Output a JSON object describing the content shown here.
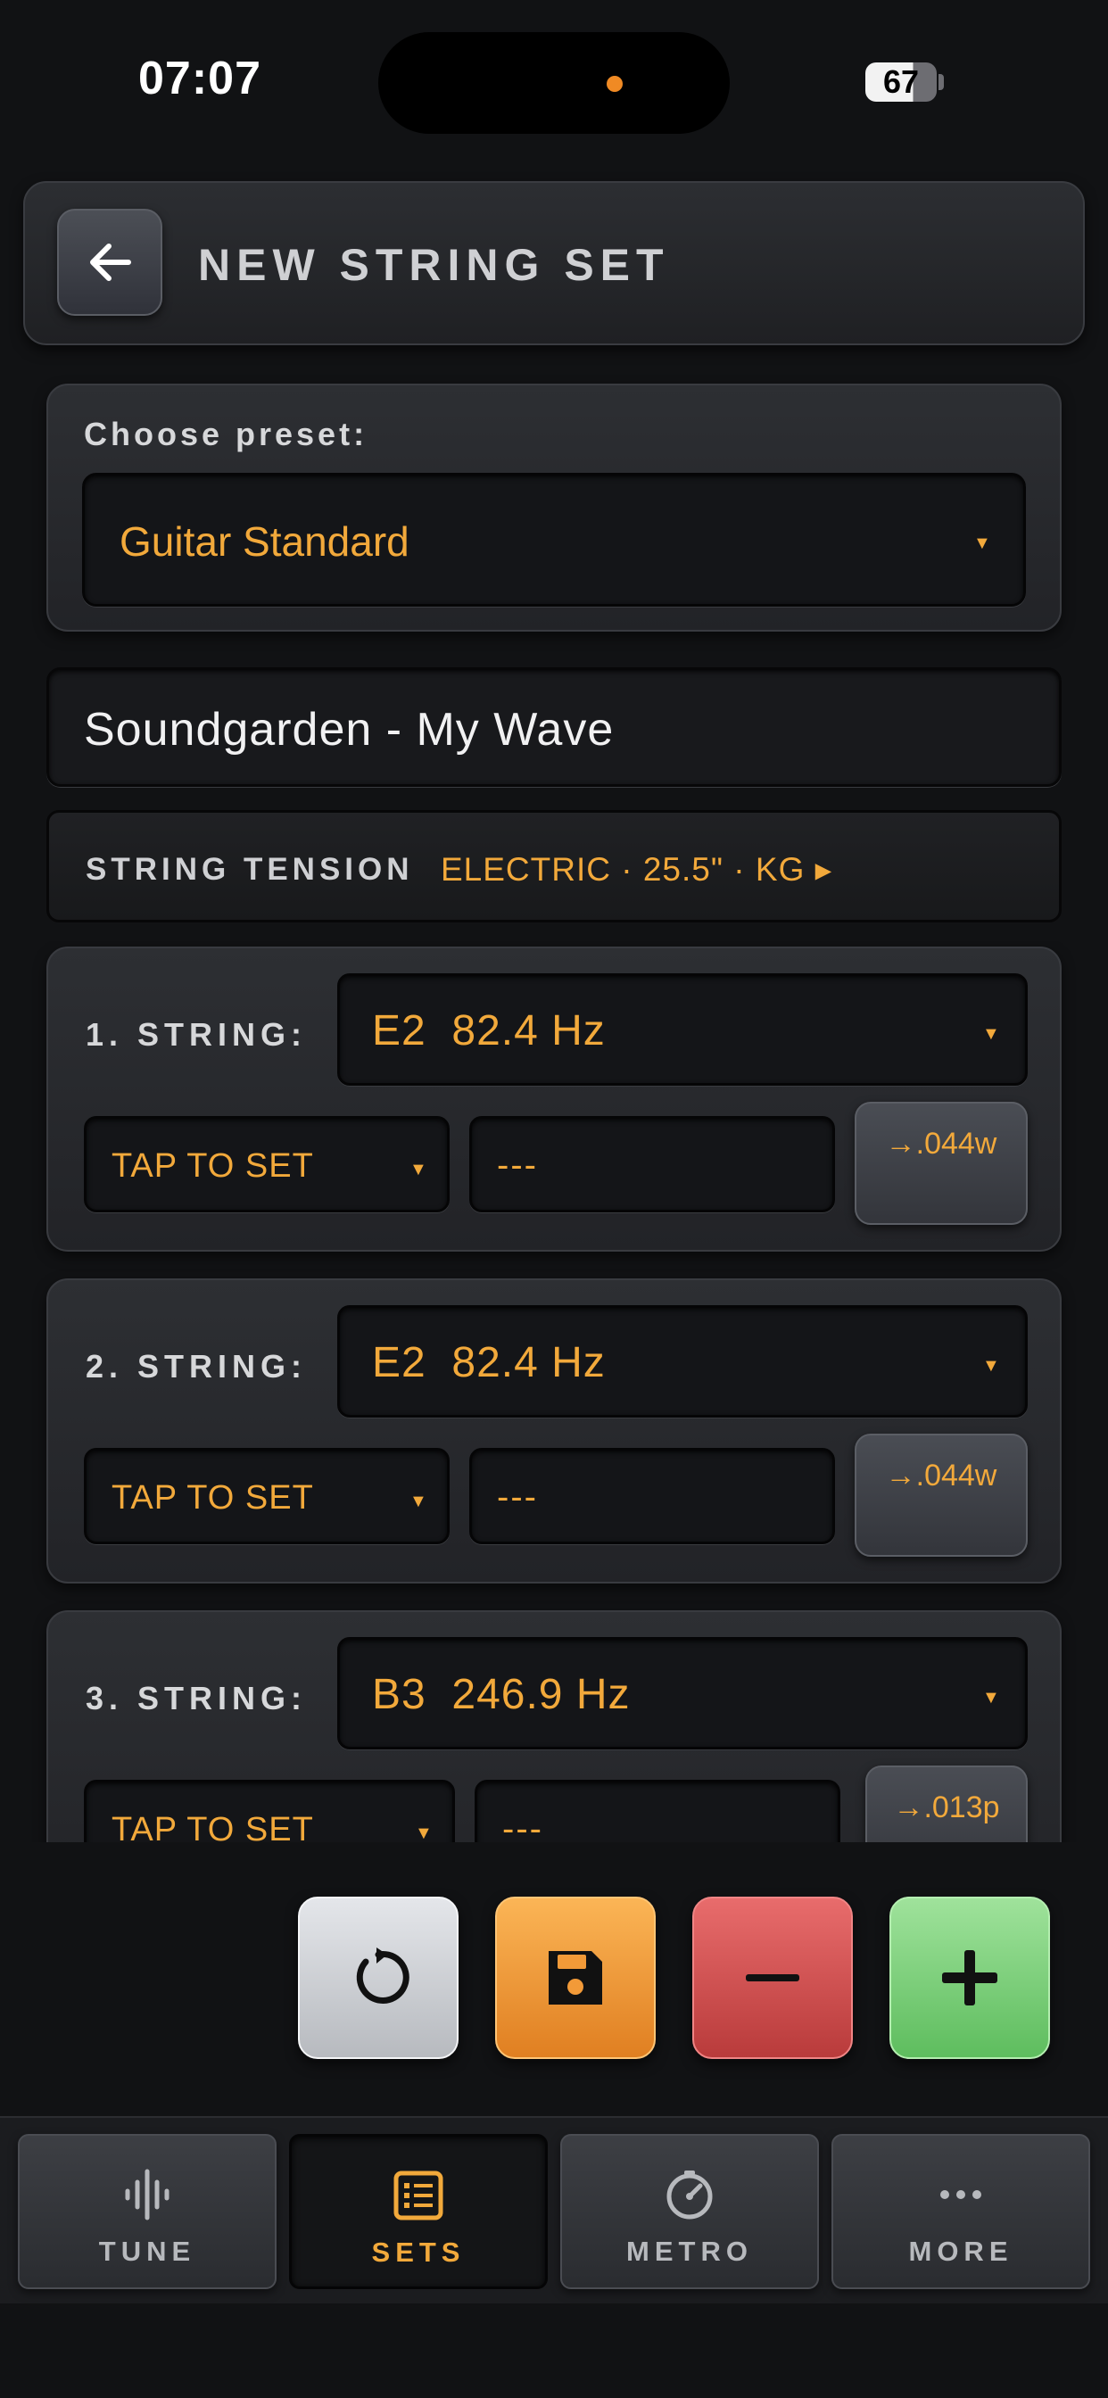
{
  "status": {
    "time": "07:07",
    "battery": "67"
  },
  "header": {
    "title": "NEW STRING SET",
    "back_icon": "arrow-left-icon"
  },
  "preset": {
    "label": "Choose preset:",
    "value": "Guitar Standard"
  },
  "set_name": {
    "value": "Soundgarden - My Wave"
  },
  "tension": {
    "label": "STRING TENSION",
    "value": "ELECTRIC · 25.5\" · KG ▸"
  },
  "strings": [
    {
      "label": "1. STRING:",
      "note": "E2  82.4 Hz",
      "tap": "TAP TO SET",
      "gauge": "---",
      "suggest": "→.044w"
    },
    {
      "label": "2. STRING:",
      "note": "E2  82.4 Hz",
      "tap": "TAP TO SET",
      "gauge": "---",
      "suggest": "→.044w"
    },
    {
      "label": "3. STRING:",
      "note": "B3  246.9 Hz",
      "tap": "TAP TO SET",
      "gauge": "---",
      "suggest": "→.013p"
    }
  ],
  "actions": {
    "reset_icon": "refresh-icon",
    "save_icon": "floppy-disk-icon",
    "remove_icon": "minus-icon",
    "add_icon": "plus-icon"
  },
  "nav": [
    {
      "label": "TUNE",
      "icon": "waveform-icon",
      "active": false
    },
    {
      "label": "SETS",
      "icon": "list-icon",
      "active": true
    },
    {
      "label": "METRO",
      "icon": "metronome-icon",
      "active": false
    },
    {
      "label": "MORE",
      "icon": "ellipsis-icon",
      "active": false
    }
  ],
  "colors": {
    "accent": "#f2a93b",
    "background": "#111214",
    "save": "#f29a38",
    "remove": "#d85454",
    "add": "#7fd27c"
  }
}
